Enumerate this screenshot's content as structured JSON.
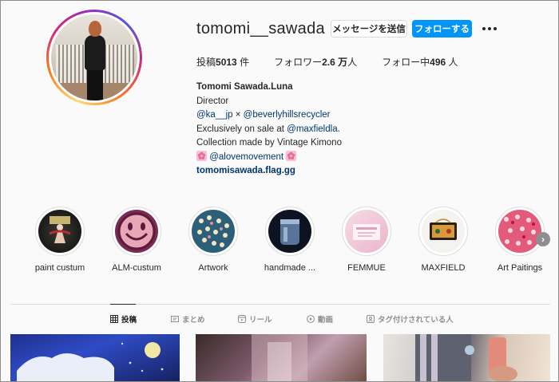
{
  "profile": {
    "username": "tomomi__sawada",
    "message_button": "メッセージを送信",
    "follow_button": "フォローする"
  },
  "stats": {
    "posts_label": "投稿",
    "posts_value": "5013",
    "posts_unit": "件",
    "followers_label": "フォロワー",
    "followers_value": "2.6 万",
    "followers_unit": "人",
    "following_label": "フォロー中",
    "following_value": "496",
    "following_unit": "人"
  },
  "bio": {
    "name": "Tomomi Sawada.Luna",
    "line1": "Director",
    "line2_a": "@ka__jp",
    "line2_sep": " × ",
    "line2_b": "@beverlyhillsrecycler",
    "line3_a": "Exclusively on sale at ",
    "line3_b": "@maxfieldla.",
    "line4": "Collection made by Vintage Kimono",
    "line5": "@alovemovement",
    "website": "tomomisawada.flag.gg"
  },
  "highlights": [
    {
      "label": "paint custum",
      "icon": "painted-jacket"
    },
    {
      "label": "ALM-custum",
      "icon": "smiley-face"
    },
    {
      "label": "Artwork",
      "icon": "floral-art"
    },
    {
      "label": "handmade ...",
      "icon": "glass-jar"
    },
    {
      "label": "FEMMUE",
      "icon": "femmue-card"
    },
    {
      "label": "MAXFIELD",
      "icon": "handbag"
    },
    {
      "label": "Art Paitings",
      "icon": "red-pattern"
    }
  ],
  "tabs": [
    {
      "label": "投稿",
      "icon": "grid-icon",
      "active": true
    },
    {
      "label": "まとめ",
      "icon": "guide-icon",
      "active": false
    },
    {
      "label": "リール",
      "icon": "reels-icon",
      "active": false
    },
    {
      "label": "動画",
      "icon": "play-icon",
      "active": false
    },
    {
      "label": "タグ付けされている人",
      "icon": "tag-icon",
      "active": false
    }
  ],
  "colors": {
    "accent": "#0095f6",
    "link": "#00376b",
    "text": "#262626",
    "muted": "#8e8e8e"
  }
}
